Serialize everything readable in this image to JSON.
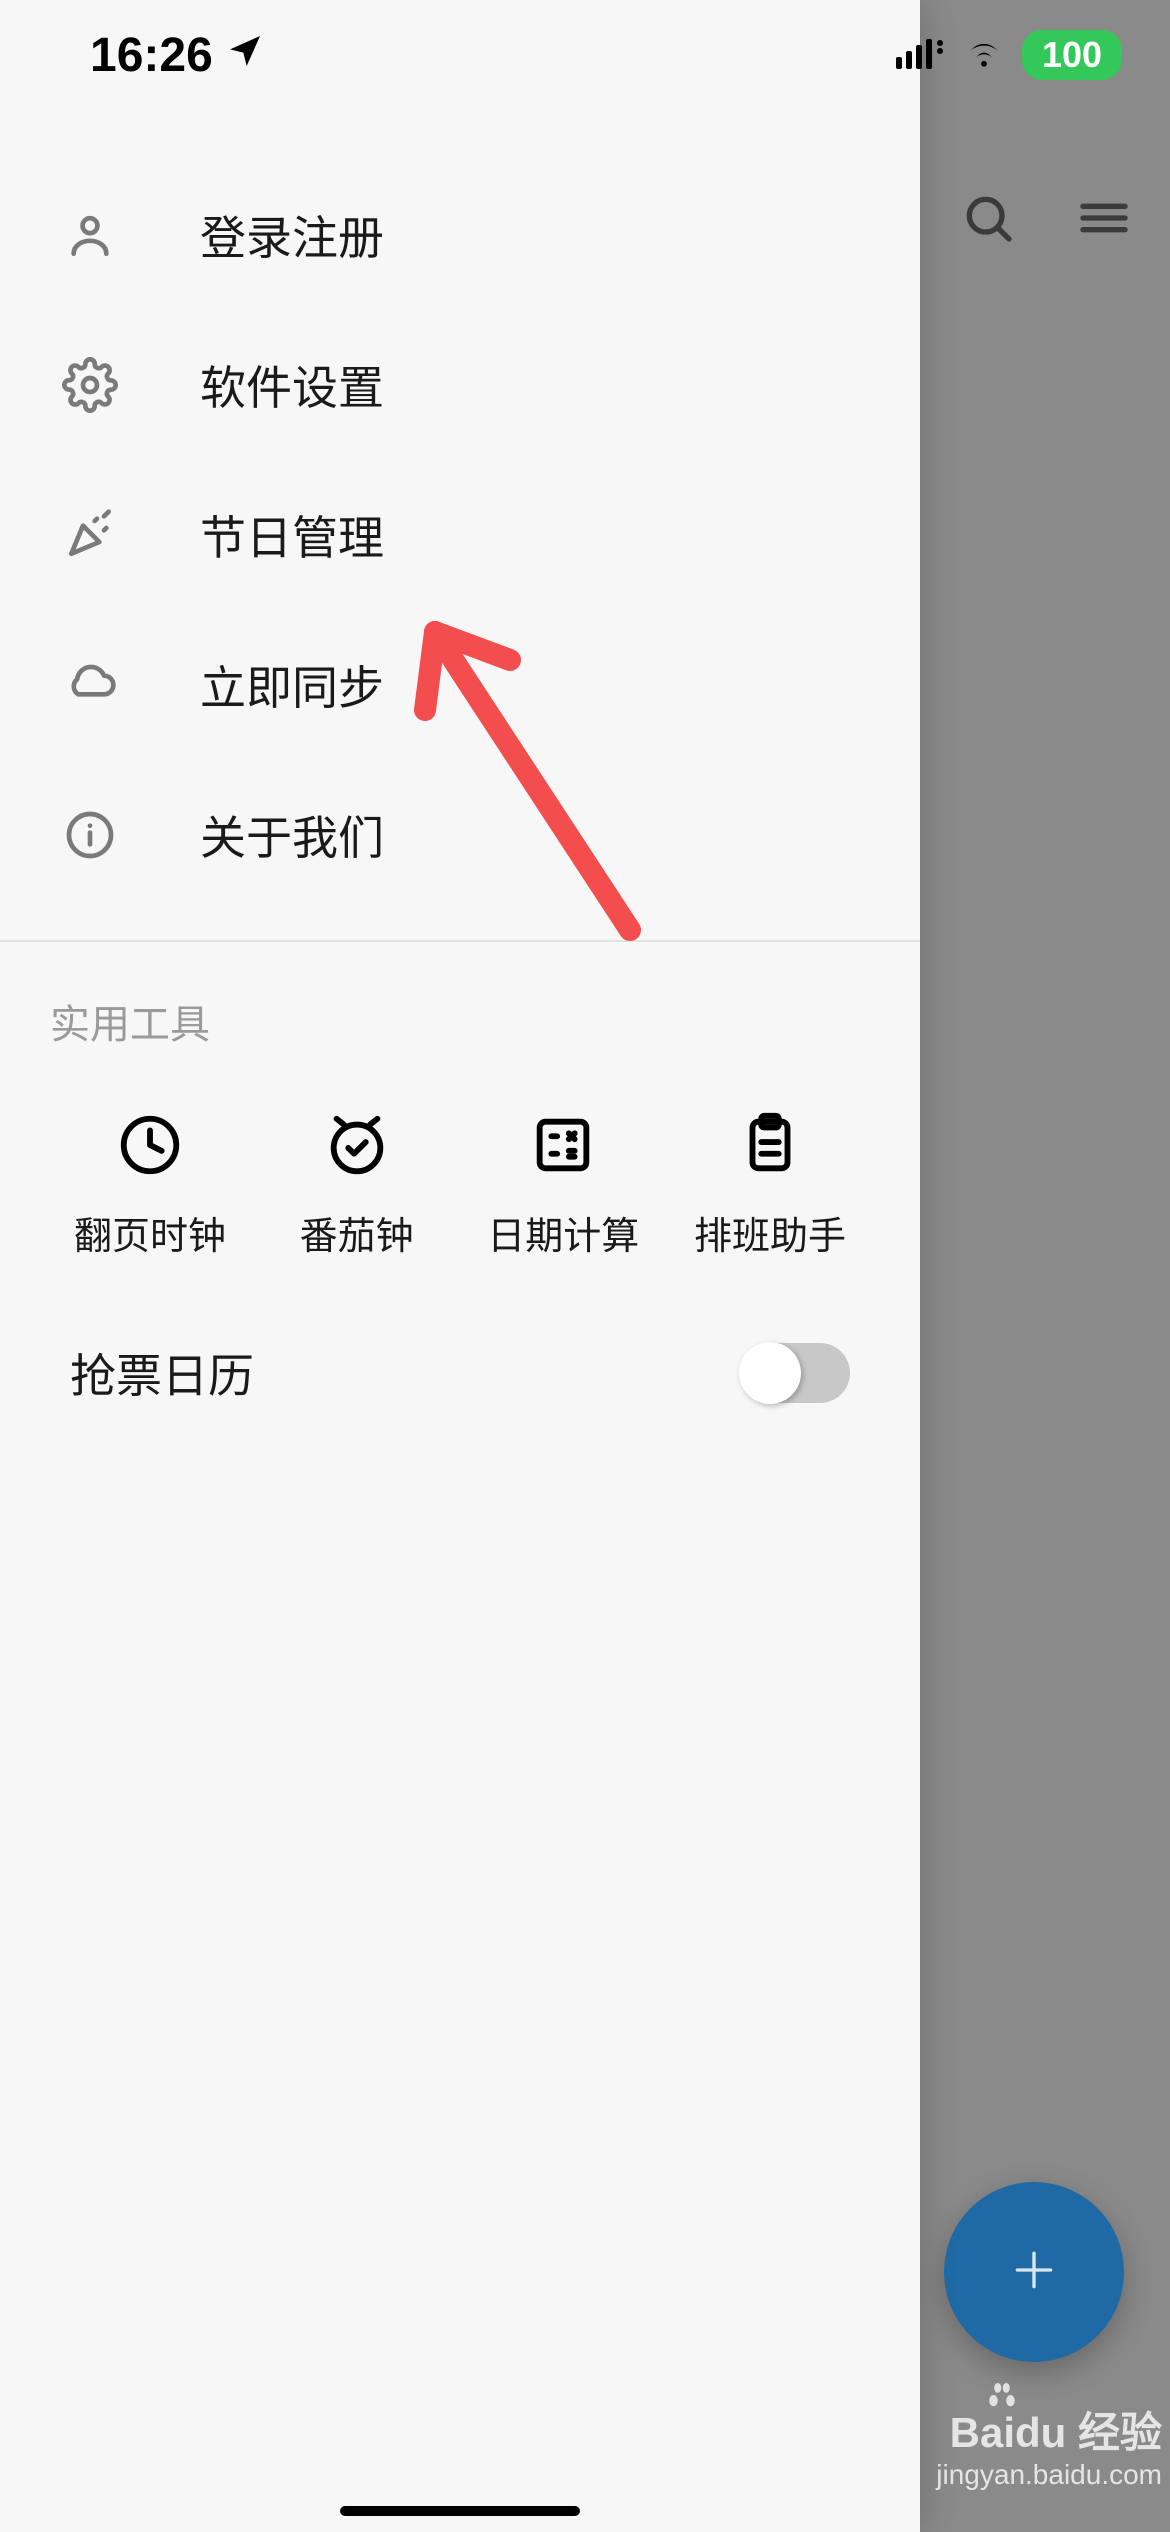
{
  "status": {
    "time": "16:26",
    "battery": "100"
  },
  "menu": {
    "login": "登录注册",
    "settings": "软件设置",
    "holidays": "节日管理",
    "sync": "立即同步",
    "about": "关于我们"
  },
  "tools": {
    "title": "实用工具",
    "flip_clock": "翻页时钟",
    "pomodoro": "番茄钟",
    "date_calc": "日期计算",
    "shift_helper": "排班助手"
  },
  "toggle": {
    "ticket_calendar_label": "抢票日历"
  },
  "watermark": {
    "brand": "Baidu 经验",
    "url": "jingyan.baidu.com"
  }
}
